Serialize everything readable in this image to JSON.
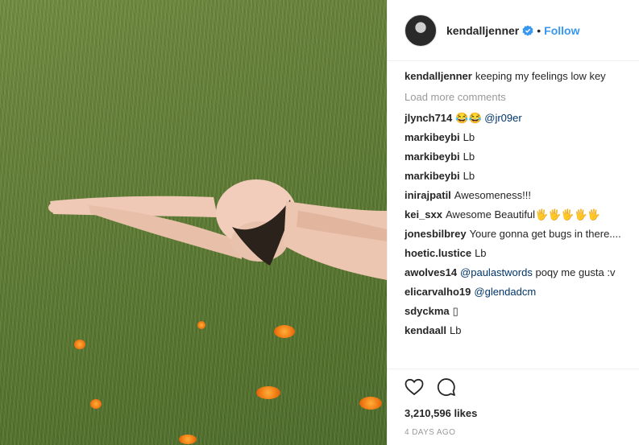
{
  "colors": {
    "accent": "#3897f0",
    "mention": "#003569",
    "muted": "#999999",
    "text": "#262626"
  },
  "photo": {
    "subject": "photo"
  },
  "header": {
    "username": "kendalljenner",
    "separator": "•",
    "follow_label": "Follow",
    "verified_icon": "verified-badge-icon"
  },
  "caption": {
    "user": "kendalljenner",
    "text": "keeping my feelings low key"
  },
  "load_more": "Load more comments",
  "comments": [
    {
      "user": "jlynch714",
      "text": "😂😂",
      "mention": "@jr09er"
    },
    {
      "user": "markibeybi",
      "text": "Lb",
      "mention": ""
    },
    {
      "user": "markibeybi",
      "text": "Lb",
      "mention": ""
    },
    {
      "user": "markibeybi",
      "text": "Lb",
      "mention": ""
    },
    {
      "user": "inirajpatil",
      "text": "Awesomeness!!!",
      "mention": ""
    },
    {
      "user": "kei_sxx",
      "text": "Awesome Beautiful🖐🖐🖐🖐🖐",
      "mention": ""
    },
    {
      "user": "jonesbilbrey",
      "text": "Youre gonna get bugs in there....",
      "mention": ""
    },
    {
      "user": "hoetic.lustice",
      "text": "Lb",
      "mention": ""
    },
    {
      "user": "awolves14",
      "text": "",
      "mention": "@paulastwords",
      "after": "poqy me gusta :v"
    },
    {
      "user": "elicarvalho19",
      "text": "",
      "mention": "@glendadcm"
    },
    {
      "user": "sdyckma",
      "text": "▯",
      "mention": ""
    },
    {
      "user": "kendaall",
      "text": "Lb",
      "mention": ""
    }
  ],
  "actions": {
    "like_icon": "heart-icon",
    "comment_icon": "comment-bubble-icon",
    "likes": "3,210,596 likes",
    "timestamp": "4 DAYS AGO"
  }
}
